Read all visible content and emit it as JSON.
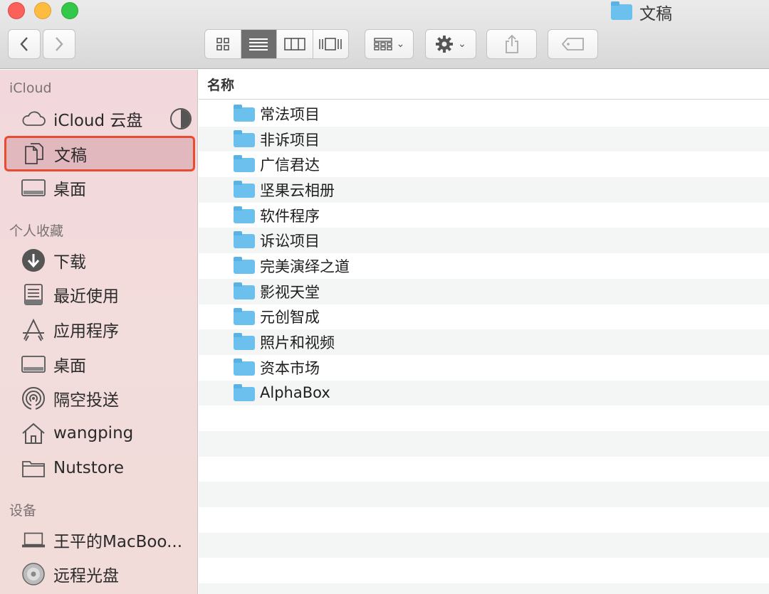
{
  "window": {
    "title": "文稿"
  },
  "toolbar": {
    "back_icon": "chevron-left-icon",
    "forward_icon": "chevron-right-icon",
    "view_modes": [
      "icon-view",
      "list-view",
      "column-view",
      "cover-flow-view"
    ],
    "active_view": "list-view",
    "arrange_icon": "arrange-grid-icon",
    "action_icon": "gear-icon",
    "share_icon": "share-icon",
    "tag_icon": "tag-icon"
  },
  "sidebar": {
    "sections": [
      {
        "title": "iCloud",
        "items": [
          {
            "label": "iCloud 云盘",
            "icon": "cloud-icon"
          },
          {
            "label": "文稿",
            "icon": "document-icon",
            "selected": true
          },
          {
            "label": "桌面",
            "icon": "desktop-icon"
          }
        ]
      },
      {
        "title": "个人收藏",
        "items": [
          {
            "label": "下载",
            "icon": "download-icon"
          },
          {
            "label": "最近使用",
            "icon": "recents-icon"
          },
          {
            "label": "应用程序",
            "icon": "applications-icon"
          },
          {
            "label": "桌面",
            "icon": "desktop-icon"
          },
          {
            "label": "隔空投送",
            "icon": "airdrop-icon"
          },
          {
            "label": "wangping",
            "icon": "home-icon"
          },
          {
            "label": "Nutstore",
            "icon": "folder-icon"
          }
        ]
      },
      {
        "title": "设备",
        "items": [
          {
            "label": "王平的MacBoo...",
            "icon": "laptop-icon"
          },
          {
            "label": "远程光盘",
            "icon": "disc-icon"
          }
        ]
      }
    ]
  },
  "list": {
    "column_header": "名称",
    "files": [
      "常法项目",
      "非诉项目",
      "广信君达",
      "坚果云相册",
      "软件程序",
      "诉讼项目",
      "完美演绎之道",
      "影视天堂",
      "元创智成",
      "照片和视频",
      "资本市场",
      "AlphaBox"
    ]
  },
  "colors": {
    "selection_outline": "#e84c2f",
    "sidebar_bg": "#f3dadc",
    "folder": "#6cc0ee"
  }
}
